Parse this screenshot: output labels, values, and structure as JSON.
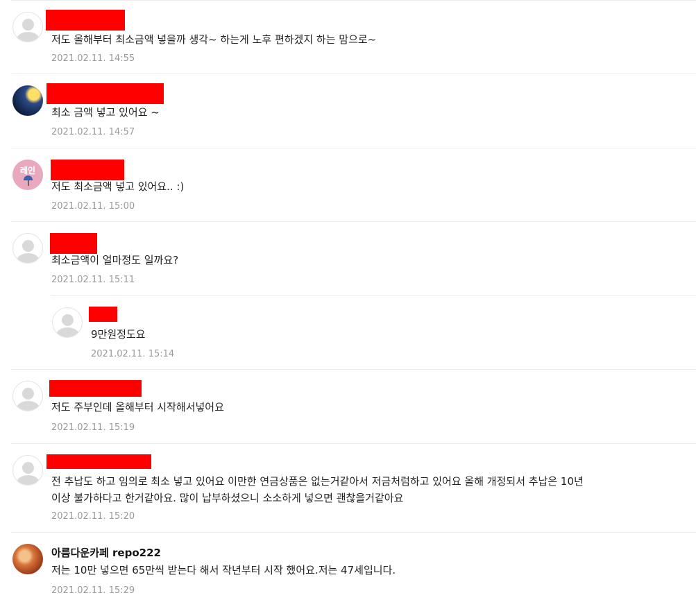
{
  "comments": [
    {
      "author": "",
      "text": "저도 올해부터 최소금액 넣을까 생각~ 하는게 노후 편하겠지 하는 맘으로~",
      "date": "2021.02.11. 14:55"
    },
    {
      "author": "",
      "text": "최소 금액 넣고 있어요 ~",
      "date": "2021.02.11. 14:57"
    },
    {
      "author": "",
      "avatar_text": "레인",
      "text": "저도 최소금액 넣고 있어요.. :)",
      "date": "2021.02.11. 15:00"
    },
    {
      "author": "",
      "text": "최소금액이 얼마정도 일까요?",
      "date": "2021.02.11. 15:11"
    },
    {
      "author": "",
      "text": "9만원정도요",
      "date": "2021.02.11. 15:14",
      "reply": true
    },
    {
      "author": "",
      "text": "저도 주부인데 올해부터 시작해서넣어요",
      "date": "2021.02.11. 15:19"
    },
    {
      "author": "",
      "text_line1": "전 추납도 하고 임의로 최소 넣고 있어요 이만한 연금상품은 없는거같아서 저금처럼하고 있어요 올해 개정되서 추납은 10년",
      "text_line2": "이상 불가하다고 한거같아요. 많이 납부하셨으니 소소하게 넣으면 괜찮을거같아요",
      "date": "2021.02.11. 15:20"
    },
    {
      "author": "아름다운카페 repo222",
      "text": "저는 10만 넣으면 65만씩 받는다 해서 작년부터 시작 했어요.저는 47세입니다.",
      "date": "2021.02.11. 15:29"
    }
  ],
  "redaction_color": "#ff0000"
}
